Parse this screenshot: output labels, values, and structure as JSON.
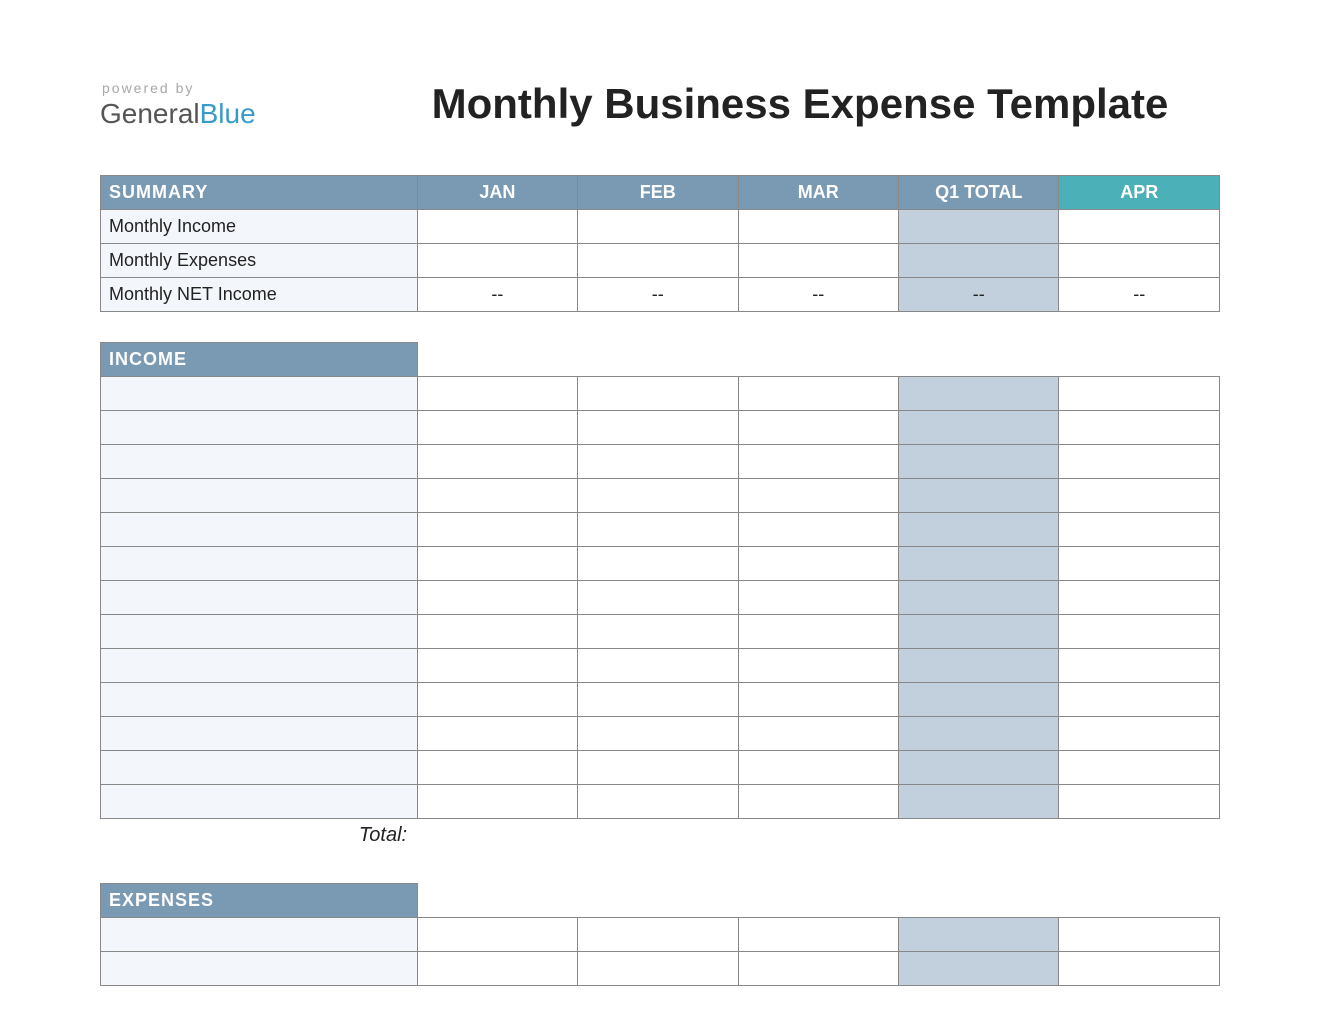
{
  "branding": {
    "powered_by": "powered by",
    "brand_general": "General",
    "brand_blue": "Blue"
  },
  "title": "Monthly Business Expense Template",
  "columns": [
    "JAN",
    "FEB",
    "MAR",
    "Q1 TOTAL",
    "APR"
  ],
  "summary": {
    "header": "SUMMARY",
    "rows": [
      {
        "label": "Monthly Income",
        "jan": "",
        "feb": "",
        "mar": "",
        "q1": "",
        "apr": ""
      },
      {
        "label": "Monthly Expenses",
        "jan": "",
        "feb": "",
        "mar": "",
        "q1": "",
        "apr": ""
      },
      {
        "label": "Monthly NET Income",
        "jan": "--",
        "feb": "--",
        "mar": "--",
        "q1": "--",
        "apr": "--"
      }
    ]
  },
  "income": {
    "header": "INCOME",
    "rows": [
      {
        "label": "",
        "jan": "",
        "feb": "",
        "mar": "",
        "q1": "",
        "apr": ""
      },
      {
        "label": "",
        "jan": "",
        "feb": "",
        "mar": "",
        "q1": "",
        "apr": ""
      },
      {
        "label": "",
        "jan": "",
        "feb": "",
        "mar": "",
        "q1": "",
        "apr": ""
      },
      {
        "label": "",
        "jan": "",
        "feb": "",
        "mar": "",
        "q1": "",
        "apr": ""
      },
      {
        "label": "",
        "jan": "",
        "feb": "",
        "mar": "",
        "q1": "",
        "apr": ""
      },
      {
        "label": "",
        "jan": "",
        "feb": "",
        "mar": "",
        "q1": "",
        "apr": ""
      },
      {
        "label": "",
        "jan": "",
        "feb": "",
        "mar": "",
        "q1": "",
        "apr": ""
      },
      {
        "label": "",
        "jan": "",
        "feb": "",
        "mar": "",
        "q1": "",
        "apr": ""
      },
      {
        "label": "",
        "jan": "",
        "feb": "",
        "mar": "",
        "q1": "",
        "apr": ""
      },
      {
        "label": "",
        "jan": "",
        "feb": "",
        "mar": "",
        "q1": "",
        "apr": ""
      },
      {
        "label": "",
        "jan": "",
        "feb": "",
        "mar": "",
        "q1": "",
        "apr": ""
      },
      {
        "label": "",
        "jan": "",
        "feb": "",
        "mar": "",
        "q1": "",
        "apr": ""
      },
      {
        "label": "",
        "jan": "",
        "feb": "",
        "mar": "",
        "q1": "",
        "apr": ""
      }
    ],
    "total_label": "Total:"
  },
  "expenses": {
    "header": "EXPENSES",
    "rows": [
      {
        "label": "",
        "jan": "",
        "feb": "",
        "mar": "",
        "q1": "",
        "apr": ""
      },
      {
        "label": "",
        "jan": "",
        "feb": "",
        "mar": "",
        "q1": "",
        "apr": ""
      }
    ]
  }
}
